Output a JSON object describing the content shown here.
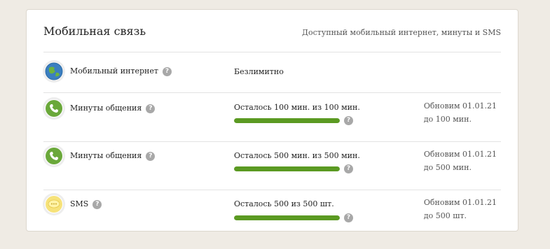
{
  "header": {
    "title": "Мобильная связь",
    "subtitle": "Доступный мобильный интернет, минуты и SMS"
  },
  "help_glyph": "?",
  "colors": {
    "progress": "#5b9a22",
    "track": "#dedede",
    "help": "#a8a8a8"
  },
  "rows": [
    {
      "icon": "globe-icon",
      "label": "Мобильный интернет",
      "value": "Безлимитно"
    },
    {
      "icon": "phone-icon",
      "label": "Минуты общения",
      "value": "Осталось 100 мин. из 100 мин.",
      "progress": 1.0,
      "renew_date": "Обновим 01.01.21",
      "renew_amount": "до 100 мин."
    },
    {
      "icon": "phone-icon",
      "label": "Минуты общения",
      "value": "Осталось 500 мин. из 500 мин.",
      "progress": 1.0,
      "renew_date": "Обновим 01.01.21",
      "renew_amount": "до 500 мин."
    },
    {
      "icon": "sms-icon",
      "label": "SMS",
      "value": "Осталось 500 из 500 шт.",
      "progress": 1.0,
      "renew_date": "Обновим 01.01.21",
      "renew_amount": "до 500 шт."
    }
  ]
}
